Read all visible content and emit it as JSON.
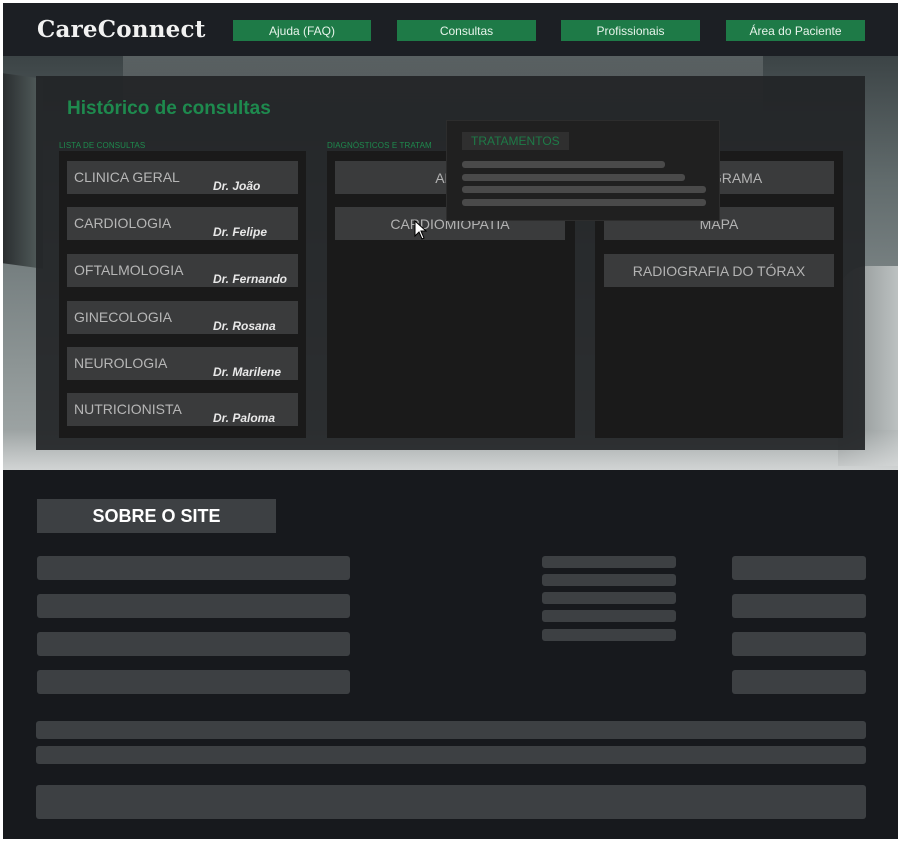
{
  "header": {
    "logo": "CareConnect",
    "nav": [
      "Ajuda (FAQ)",
      "Consultas",
      "Profissionais",
      "Área do Paciente"
    ]
  },
  "history": {
    "title": "Histórico de consultas",
    "list_label": "LISTA DE CONSULTAS",
    "diagnostics_label": "DIAGNÓSTICOS E TRATAM",
    "consultations": [
      {
        "specialty": "CLINICA GERAL",
        "doctor": "Dr. João"
      },
      {
        "specialty": "CARDIOLOGIA",
        "doctor": "Dr. Felipe"
      },
      {
        "specialty": "OFTALMOLOGIA",
        "doctor": "Dr. Fernando"
      },
      {
        "specialty": "GINECOLOGIA",
        "doctor": "Dr. Rosana"
      },
      {
        "specialty": "NEUROLOGIA",
        "doctor": "Dr. Marilene"
      },
      {
        "specialty": "NUTRICIONISTA",
        "doctor": "Dr. Paloma"
      }
    ],
    "diagnostics": [
      "ARR",
      "CARDIOMIOPATIA"
    ],
    "exams": [
      "RDIOGRAMA",
      "MAPA",
      "RADIOGRAFIA DO TÓRAX"
    ],
    "popup_tag": "TRATAMENTOS"
  },
  "about": {
    "title": "SOBRE O SITE"
  },
  "colors": {
    "accent": "#1e7a47",
    "accent_text": "#1e8a4e",
    "background": "#17191d",
    "panel": "#222426",
    "placeholder": "#3d4043"
  },
  "icons": {
    "cursor": "pointer-cursor-icon"
  }
}
